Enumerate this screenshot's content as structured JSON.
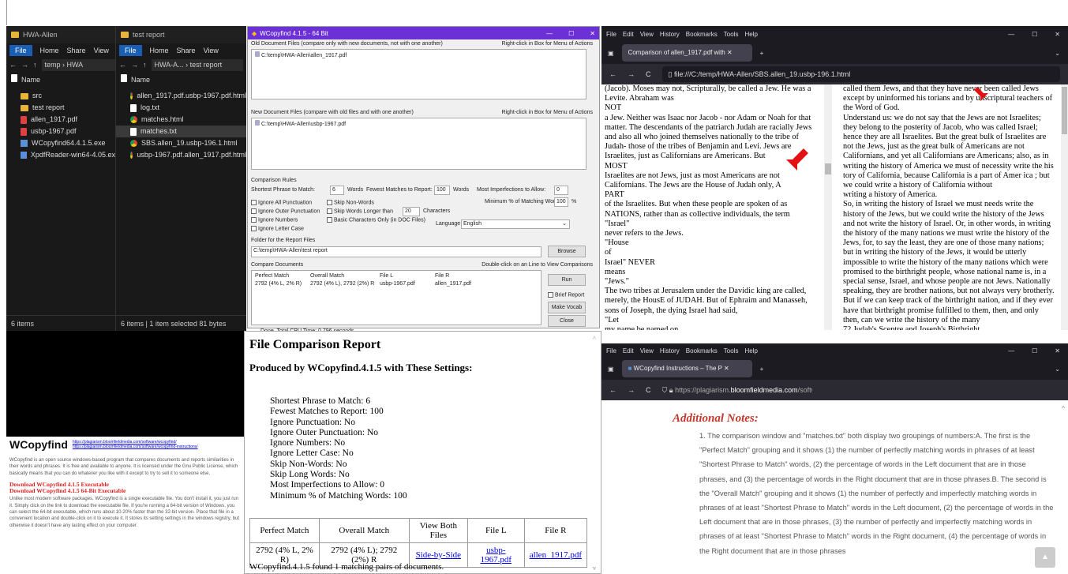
{
  "explorer_left": {
    "title_text": "HWA-Allen",
    "ribbon": [
      "File",
      "Home",
      "Share",
      "View"
    ],
    "breadcrumb": "temp › HWA",
    "column_header": "Name",
    "items": [
      {
        "name": "src",
        "icon": "folder-icon"
      },
      {
        "name": "test report",
        "icon": "folder-icon"
      },
      {
        "name": "allen_1917.pdf",
        "icon": "pdf-icon"
      },
      {
        "name": "usbp-1967.pdf",
        "icon": "pdf-icon"
      },
      {
        "name": "WCopyfind64.4.1.5.exe",
        "icon": "app-icon"
      },
      {
        "name": "XpdfReader-win64-4.05.exe",
        "icon": "app-icon"
      }
    ],
    "status": "6 items"
  },
  "explorer_right": {
    "title_text": "test report",
    "ribbon": [
      "File",
      "Home",
      "Share",
      "View"
    ],
    "breadcrumb": "HWA-A... › test report",
    "column_header": "Name",
    "items": [
      {
        "name": "allen_1917.pdf.usbp-1967.pdf.html",
        "icon": "chrome-icon"
      },
      {
        "name": "log.txt",
        "icon": "document-icon"
      },
      {
        "name": "matches.html",
        "icon": "chrome-icon"
      },
      {
        "name": "matches.txt",
        "icon": "document-icon"
      },
      {
        "name": "SBS.allen_19.usbp-196.1.html",
        "icon": "chrome-icon"
      },
      {
        "name": "usbp-1967.pdf.allen_1917.pdf.html",
        "icon": "chrome-icon"
      }
    ],
    "status": "6 items  |  1 item selected  81 bytes"
  },
  "wcopyfind": {
    "title": "WCopyfind 4.1.5 - 64 Bit",
    "old_label": "Old Document Files (compare only with new documents, not with one another)",
    "old_hint": "Right-click in Box for Menu of Actions",
    "old_file": "C:\\temp\\HWA-Allen\\allen_1917.pdf",
    "new_label": "New Document Files (compare with old files and with one another)",
    "new_hint": "Right-click in Box for Menu of Actions",
    "new_file": "C:\\temp\\HWA-Allen\\usbp-1967.pdf",
    "rules_label": "Comparison Rules",
    "shortest_label": "Shortest Phrase to Match:",
    "shortest_val": "6",
    "words1": "Words",
    "fewest_label": "Fewest Matches to Report:",
    "fewest_val": "100",
    "words2": "Words",
    "imperf_label": "Most Imperfections to Allow:",
    "imperf_val": "0",
    "minpct_label": "Minimum % of Matching Words:",
    "minpct_val": "100",
    "pct": "%",
    "cb_ignore_punct": "Ignore All Punctuation",
    "cb_ignore_outer": "Ignore Outer Punctuation",
    "cb_ignore_numbers": "Ignore Numbers",
    "cb_ignore_case": "Ignore Letter Case",
    "cb_skip_nonwords": "Skip Non-Words",
    "cb_skip_longer": "Skip Words Longer than",
    "skip_longer_val": "20",
    "characters": "Characters",
    "cb_basic": "Basic Characters Only (in DOC Files)",
    "language_label": "Language",
    "language_val": "English",
    "folder_label": "Folder for the Report Files",
    "folder_val": "C:\\temp\\HWA-Allen\\test report",
    "browse": "Browse",
    "compare_label": "Compare Documents",
    "compare_hint": "Double-click on an Line to View Comparisons",
    "table_headers": [
      "Perfect Match",
      "Overall Match",
      "File L",
      "File R"
    ],
    "table_row": [
      "2792 (4% L, 2% R)",
      "2792 (4% L), 2792 (2%) R",
      "usbp-1967.pdf",
      "allen_1917.pdf"
    ],
    "run": "Run",
    "brief": "Brief Report",
    "vocab": "Make Vocab",
    "close": "Close",
    "status": "Done. Total CPU Time: 0.796 seconds"
  },
  "ff_top": {
    "menu": [
      "File",
      "Edit",
      "View",
      "History",
      "Bookmarks",
      "Tools",
      "Help"
    ],
    "tab": "Comparison of allen_1917.pdf with",
    "url": "file:///C:/temp/HWA-Allen/SBS.allen_19.usbp-196.1.html",
    "left_text": "(Jacob). Moses may not, Scripturally, be called a Jew. He was a Levite. Abraham was\nNOT\na Jew. Neither was Isaac nor Jacob - nor Adam or Noah for that matter. The descendants of the patriarch Judah are racially Jews and also all who joined themselves nationally to the tribe of Judah- those of the tribes of Benjamin and Levi. Jews are Israelites, just as Californians are Americans. But\nMOST\nIsraelites are not Jews, just as most Americans are not Californians. The Jews are the House of Judah only, A\nPART\nof the Israelites. But when these people are spoken of as NATIONS, rather than as collective individuals, the term\n\"Israel\"\nnever refers to the Jews.\n\"House\nof\nIsrael\" NEVER\nmeans\n\"Jews.\"\nThe two tribes at Jerusalem under the Davidic king are called, merely, the HousE of JUDAH. But of Ephraim and Manasseh, sons of Joseph, the dying Israel had said,\n\"Let\nmy name be named on",
    "right_text": "called them Jews, and that they have never been called Jews except by uninformed his torians and by unscriptural teachers of the Word of God.\nUnderstand us: we do not say that the Jews are not Israelites; they belong to the posterity of Jacob, who was called Israel; hence they are all Israelites. But the great bulk of Israelites are not the Jews, just as the great bulk of Americans are not Californians, and yet all Californians are Americans; also, as in writing the history of America we must of necessity write the his tory of California, because California is a part of Amer ica ; but we could write a history of California without\nwriting a history of America.\nSo, in writing the history of Israel we must needs write the history of the Jews, but we could write the history of the Jews and not write the history of Israel. Or, in other words, in writing the history of the many nations we must write the history of the Jews, for, to say the least, they are one of those many nations; but in writing the history of the Jews, it would be utterly impossible to write the history of the many nations which were promised to the birthright people, whose national name is, in a special sense, Israel, and whose people are not Jews. Nationally speaking, they are brother nations, but not always very brotherly. But if we can keep track of the birthright nation, and if they ever have that birthright promise fulfilled to them, then, and only then, can we write the history of the many\n72 Judah's Sceptre and Joseph's Birthright"
  },
  "ff_bottom": {
    "menu": [
      "File",
      "Edit",
      "View",
      "History",
      "Bookmarks",
      "Tools",
      "Help"
    ],
    "tab": "WCopyfind Instructions – The P",
    "url_pre": "https://plagiarism.",
    "url_domain": "bloomfieldmedia.com",
    "url_post": "/software/wcop",
    "heading": "Additional Notes:",
    "para": "1. The comparison window and \"matches.txt\" both display two groupings of numbers:A. The first is the \"Perfect Match\" grouping and it shows (1) the number of perfectly matching words in phrases of at least \"Shortest Phrase to Match\" words, (2) the percentage of words in the Left document that are in those phrases, and (3) the percentage of words in the Right document that are in those phrases.B. The second is the \"Overall Match\" grouping and it shows (1) the number of perfectly and imperfectly matching words in phrases of at least \"Shortest Phrase to Match\" words in the Left document, (2) the percentage of words in the Left document that are in those phrases, (3) the number of perfectly and imperfectly matching words in phrases of at least \"Shortest Phrase to Match\" words in the Right document, (4) the percentage of words in the Right document that are in those phrases"
  },
  "report": {
    "title": "File Comparison Report",
    "subtitle": "Produced by WCopyfind.4.1.5 with These Settings:",
    "settings": [
      "Shortest Phrase to Match: 6",
      "Fewest Matches to Report: 100",
      "Ignore Punctuation: No",
      "Ignore Outer Punctuation: No",
      "Ignore Numbers: No",
      "Ignore Letter Case: No",
      "Skip Non-Words: No",
      "Skip Long Words: No",
      "Most Imperfections to Allow: 0",
      "Minimum % of Matching Words: 100"
    ],
    "headers": [
      "Perfect Match",
      "Overall Match",
      "View Both Files",
      "File L",
      "File R"
    ],
    "row": [
      "2792 (4% L, 2% R)",
      "2792 (4% L); 2792 (2%) R",
      "Side-by-Side",
      "usbp-1967.pdf",
      "allen_1917.pdf"
    ],
    "footer": "WCopyfind.4.1.5 found 1 matching pairs of documents."
  },
  "website": {
    "logo": "WCopyfind",
    "link1": "https://plagiarism.bloomfieldmedia.com/software/wcopyfind/",
    "link2": "https://plagiarism.bloomfieldmedia.com/software/wcopyfind-instructions/",
    "intro": "WCopyfind is an open source windows-based program that compares documents and reports similarities in their words and phrases. It is free and available to anyone. It is licensed under the Gnu Public License, which basically means that you can do whatever you like with it except to try to sell it to someone else.",
    "dl1": "Download WCopyfind 4.1.5 Executable",
    "dl2": "Download WCopyfind 4.1.5 64-Bit Executable",
    "body": "Unlike most modern software packages, WCopyfind is a single executable file. You don't install it, you just run it. Simply click on the link to download the executable file. If you're running a 64-bit version of Windows, you can select the 64-bit executable, which runs about 10-20% faster than the 32-bit version. Place that file in a convenient location and double-click on it to execute it. It stores its setting settings in the windows registry, but otherwise it doesn't have any lasting effect on your computer."
  }
}
